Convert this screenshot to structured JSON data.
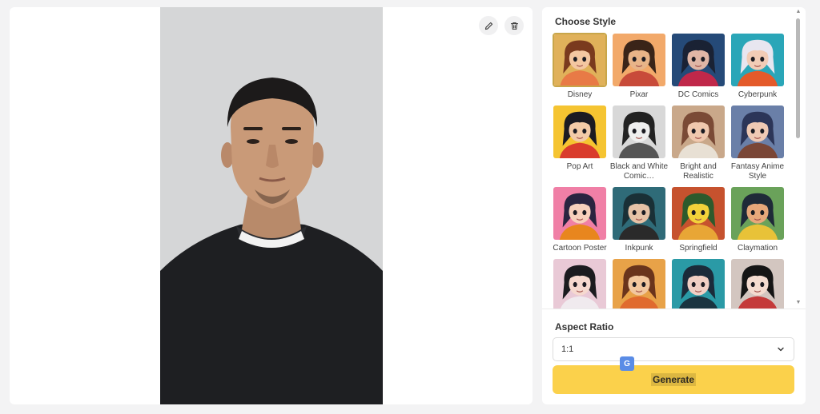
{
  "image_panel": {
    "edit_icon": "pencil-icon",
    "delete_icon": "trash-icon"
  },
  "styles_panel": {
    "title": "Choose Style",
    "selected": "Disney",
    "items": [
      {
        "label": "Disney",
        "bg": "#e0b15a",
        "hair": "#7a3a1e",
        "skin": "#f4c7a1",
        "outfit": "#e87a46"
      },
      {
        "label": "Pixar",
        "bg": "#f2a96a",
        "hair": "#3a2418",
        "skin": "#e8b488",
        "outfit": "#c84b3a"
      },
      {
        "label": "DC Comics",
        "bg": "#254a78",
        "hair": "#1a2234",
        "skin": "#e0b6a6",
        "outfit": "#c0284a"
      },
      {
        "label": "Cyberpunk",
        "bg": "#2aa6b8",
        "hair": "#e8e6f0",
        "skin": "#f2ccb6",
        "outfit": "#e45a2a"
      },
      {
        "label": "Pop Art",
        "bg": "#f5c431",
        "hair": "#1b1b22",
        "skin": "#f3cba8",
        "outfit": "#d93b2c"
      },
      {
        "label": "Black and White Comic…",
        "bg": "#d8d8d8",
        "hair": "#222222",
        "skin": "#efefef",
        "outfit": "#555555"
      },
      {
        "label": "Bright and Realistic",
        "bg": "#c9a88a",
        "hair": "#7a4a36",
        "skin": "#f0c8ae",
        "outfit": "#e8e0d4"
      },
      {
        "label": "Fantasy Anime Style",
        "bg": "#6a7fa8",
        "hair": "#2c3558",
        "skin": "#efc9b4",
        "outfit": "#7a4636"
      },
      {
        "label": "Cartoon Poster",
        "bg": "#f07fa6",
        "hair": "#2a2440",
        "skin": "#f7d0bc",
        "outfit": "#e8861e"
      },
      {
        "label": "Inkpunk",
        "bg": "#2f6b78",
        "hair": "#1a3036",
        "skin": "#e6c2a6",
        "outfit": "#2a2a2a"
      },
      {
        "label": "Springfield",
        "bg": "#c6522e",
        "hair": "#2d5a2c",
        "skin": "#f2d23a",
        "outfit": "#e8a636"
      },
      {
        "label": "Claymation",
        "bg": "#6aa25a",
        "hair": "#1f2a38",
        "skin": "#e7a77a",
        "outfit": "#e8c238"
      },
      {
        "label": "",
        "bg": "#e9c9d6",
        "hair": "#1b1b1f",
        "skin": "#f6d9cf",
        "outfit": "#f0eaee"
      },
      {
        "label": "",
        "bg": "#e8a248",
        "hair": "#6a341c",
        "skin": "#f2c79e",
        "outfit": "#e06a2e"
      },
      {
        "label": "",
        "bg": "#2a9aa6",
        "hair": "#1b2b3a",
        "skin": "#f0cfc4",
        "outfit": "#1a3440"
      },
      {
        "label": "",
        "bg": "#d3c6c0",
        "hair": "#151515",
        "skin": "#f4dcd0",
        "outfit": "#c43a3a"
      }
    ]
  },
  "aspect_ratio": {
    "title": "Aspect Ratio",
    "value": "1:1"
  },
  "generate": {
    "label": "Generate"
  },
  "colors": {
    "accent": "#fbd14b",
    "panel_bg": "#ffffff",
    "page_bg": "#f3f3f4",
    "selected_border": "#c8a64a"
  }
}
